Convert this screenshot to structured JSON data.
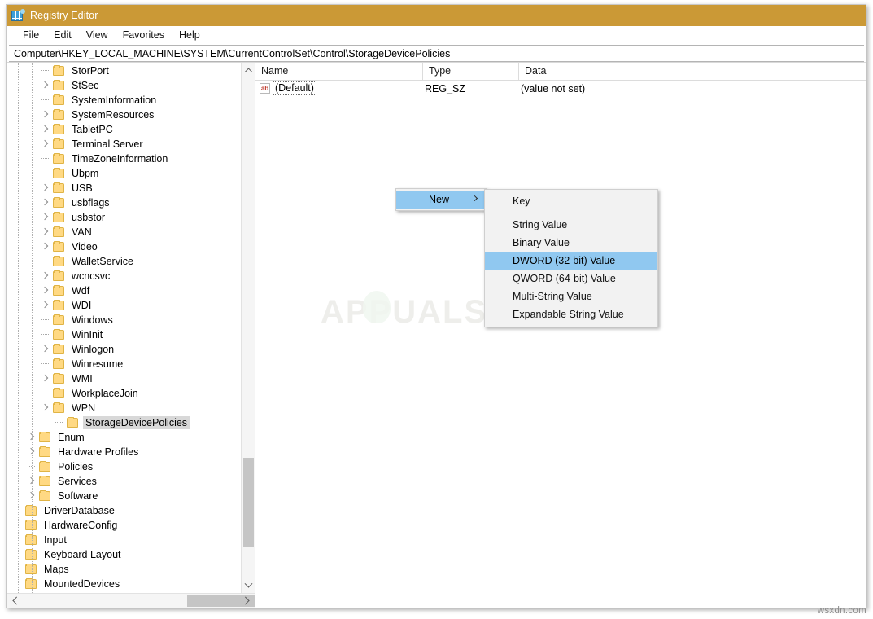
{
  "window": {
    "title": "Registry Editor",
    "icon": "registry-editor-icon",
    "titlebar_color": "#cb9936"
  },
  "menubar": {
    "items": [
      "File",
      "Edit",
      "View",
      "Favorites",
      "Help"
    ]
  },
  "address": {
    "path": "Computer\\HKEY_LOCAL_MACHINE\\SYSTEM\\CurrentControlSet\\Control\\StorageDevicePolicies"
  },
  "tree": {
    "nodes": [
      {
        "label": "StorPort",
        "depth": 2,
        "expander": "dot",
        "selected": false
      },
      {
        "label": "StSec",
        "depth": 2,
        "expander": "chev",
        "selected": false
      },
      {
        "label": "SystemInformation",
        "depth": 2,
        "expander": "dot",
        "selected": false
      },
      {
        "label": "SystemResources",
        "depth": 2,
        "expander": "chev",
        "selected": false
      },
      {
        "label": "TabletPC",
        "depth": 2,
        "expander": "chev",
        "selected": false
      },
      {
        "label": "Terminal Server",
        "depth": 2,
        "expander": "chev",
        "selected": false
      },
      {
        "label": "TimeZoneInformation",
        "depth": 2,
        "expander": "dot",
        "selected": false
      },
      {
        "label": "Ubpm",
        "depth": 2,
        "expander": "dot",
        "selected": false
      },
      {
        "label": "USB",
        "depth": 2,
        "expander": "chev",
        "selected": false
      },
      {
        "label": "usbflags",
        "depth": 2,
        "expander": "chev",
        "selected": false
      },
      {
        "label": "usbstor",
        "depth": 2,
        "expander": "chev",
        "selected": false
      },
      {
        "label": "VAN",
        "depth": 2,
        "expander": "chev",
        "selected": false
      },
      {
        "label": "Video",
        "depth": 2,
        "expander": "chev",
        "selected": false
      },
      {
        "label": "WalletService",
        "depth": 2,
        "expander": "dot",
        "selected": false
      },
      {
        "label": "wcncsvc",
        "depth": 2,
        "expander": "chev",
        "selected": false
      },
      {
        "label": "Wdf",
        "depth": 2,
        "expander": "chev",
        "selected": false
      },
      {
        "label": "WDI",
        "depth": 2,
        "expander": "chev",
        "selected": false
      },
      {
        "label": "Windows",
        "depth": 2,
        "expander": "dot",
        "selected": false
      },
      {
        "label": "WinInit",
        "depth": 2,
        "expander": "dot",
        "selected": false
      },
      {
        "label": "Winlogon",
        "depth": 2,
        "expander": "chev",
        "selected": false
      },
      {
        "label": "Winresume",
        "depth": 2,
        "expander": "dot",
        "selected": false
      },
      {
        "label": "WMI",
        "depth": 2,
        "expander": "chev",
        "selected": false
      },
      {
        "label": "WorkplaceJoin",
        "depth": 2,
        "expander": "dot",
        "selected": false
      },
      {
        "label": "WPN",
        "depth": 2,
        "expander": "chev",
        "selected": false
      },
      {
        "label": "StorageDevicePolicies",
        "depth": 3,
        "expander": "dot",
        "selected": true
      },
      {
        "label": "Enum",
        "depth": 1,
        "expander": "chev",
        "selected": false
      },
      {
        "label": "Hardware Profiles",
        "depth": 1,
        "expander": "chev",
        "selected": false
      },
      {
        "label": "Policies",
        "depth": 1,
        "expander": "dot",
        "selected": false
      },
      {
        "label": "Services",
        "depth": 1,
        "expander": "chev",
        "selected": false
      },
      {
        "label": "Software",
        "depth": 1,
        "expander": "chev",
        "selected": false
      },
      {
        "label": "DriverDatabase",
        "depth": 0,
        "expander": "none",
        "selected": false
      },
      {
        "label": "HardwareConfig",
        "depth": 0,
        "expander": "none",
        "selected": false
      },
      {
        "label": "Input",
        "depth": 0,
        "expander": "none",
        "selected": false
      },
      {
        "label": "Keyboard Layout",
        "depth": 0,
        "expander": "none",
        "selected": false
      },
      {
        "label": "Maps",
        "depth": 0,
        "expander": "none",
        "selected": false
      },
      {
        "label": "MountedDevices",
        "depth": 0,
        "expander": "none",
        "selected": false
      }
    ]
  },
  "listview": {
    "columns": [
      "Name",
      "Type",
      "Data"
    ],
    "rows": [
      {
        "name": "(Default)",
        "type": "REG_SZ",
        "data": "(value not set)",
        "icon": "string-value-icon"
      }
    ]
  },
  "context_menu": {
    "parent": {
      "label": "New",
      "highlighted": true,
      "has_submenu": true
    },
    "submenu": {
      "items": [
        {
          "label": "Key",
          "highlighted": false
        },
        {
          "label": "String Value",
          "highlighted": false
        },
        {
          "label": "Binary Value",
          "highlighted": false
        },
        {
          "label": "DWORD (32-bit) Value",
          "highlighted": true
        },
        {
          "label": "QWORD (64-bit) Value",
          "highlighted": false
        },
        {
          "label": "Multi-String Value",
          "highlighted": false
        },
        {
          "label": "Expandable String Value",
          "highlighted": false
        }
      ],
      "separator_after_index": 0
    },
    "highlight_color": "#90c8f0"
  },
  "watermarks": {
    "center": "APPUALS",
    "corner": "wsxdn.com"
  }
}
